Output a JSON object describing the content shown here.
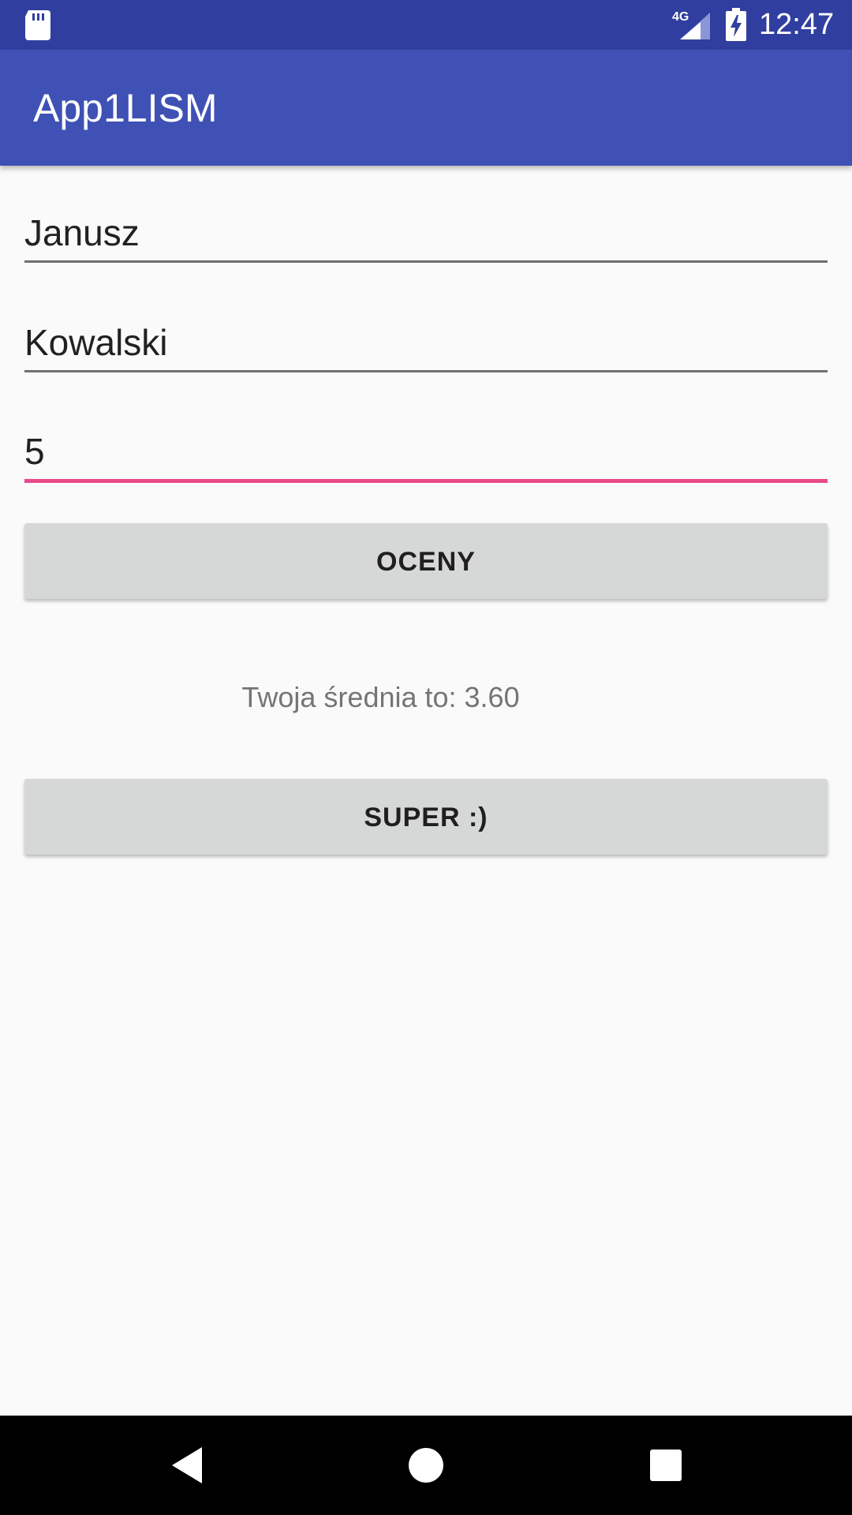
{
  "status_bar": {
    "time": "12:47",
    "network_label": "4G",
    "icons": [
      "sd-card-icon",
      "signal-icon",
      "battery-charging-icon"
    ]
  },
  "app_bar": {
    "title": "App1LISM"
  },
  "form": {
    "first_name_value": "Janusz",
    "last_name_value": "Kowalski",
    "grades_count_value": "5",
    "accent_color": "#e84a8a"
  },
  "buttons": {
    "grades_label": "OCENY",
    "super_label": "SUPER :)"
  },
  "result": {
    "text": "Twoja średnia to: 3.60"
  },
  "nav_bar": {
    "icons": [
      "back-icon",
      "home-icon",
      "recents-icon"
    ]
  },
  "colors": {
    "status_bar": "#303f9f",
    "app_bar": "#3f51b5",
    "background": "#fafafa",
    "button": "#d6d7d7"
  }
}
